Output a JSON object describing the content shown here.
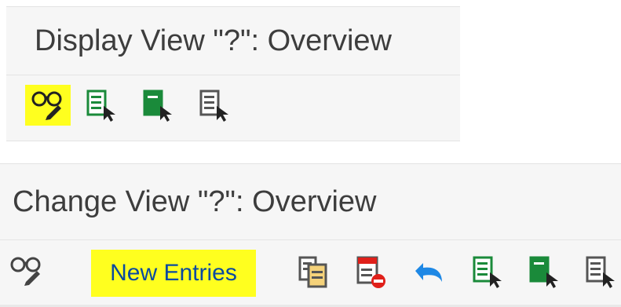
{
  "display_view": {
    "title": "Display View \"?\": Overview",
    "toolbar_icons": [
      "display-change-toggle-icon",
      "select-all-icon",
      "select-block-icon",
      "deselect-all-icon"
    ],
    "highlight_color": "#ffff1f"
  },
  "change_view": {
    "title": "Change View \"?\": Overview",
    "new_entries_label": "New Entries",
    "toolbar_icons": [
      "display-change-toggle-icon",
      "copy-as-icon",
      "delete-icon",
      "undo-icon",
      "select-all-icon",
      "select-block-icon",
      "deselect-all-icon"
    ],
    "highlight_color": "#ffff1f"
  },
  "colors": {
    "icon_green": "#1a8a3a",
    "icon_gray": "#555555",
    "undo_blue": "#1e88e5",
    "delete_red": "#e0201a"
  }
}
